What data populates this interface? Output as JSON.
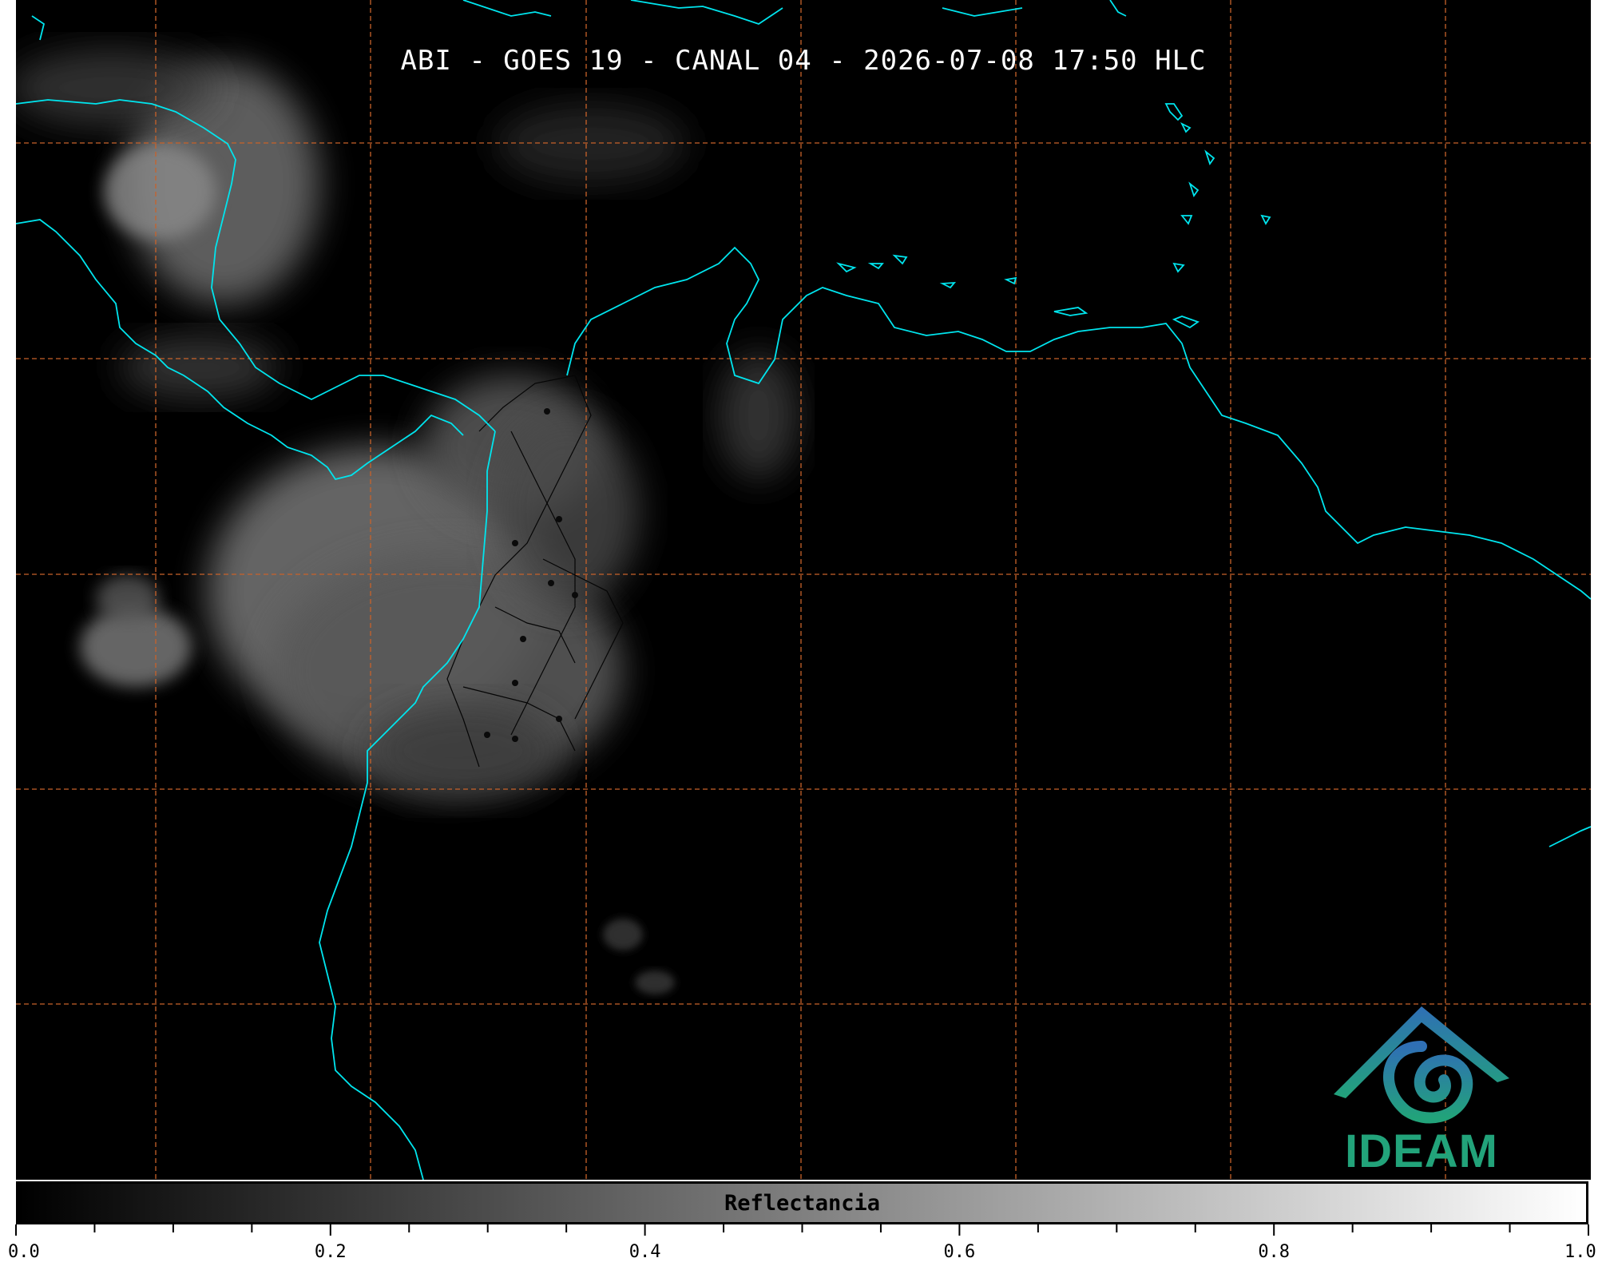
{
  "title": "ABI - GOES 19 - CANAL 04 - 2026-07-08 17:50 HLC",
  "map": {
    "coastline_color": "#00e5ee",
    "grid_color": "#c8622a",
    "background_color": "#000000",
    "borders_color": "#000000"
  },
  "colorbar": {
    "label": "Reflectancia",
    "min": 0.0,
    "max": 1.0,
    "ticks": [
      "0.0",
      "0.2",
      "0.4",
      "0.6",
      "0.8",
      "1.0"
    ],
    "colors": [
      "#000000",
      "#ffffff"
    ]
  },
  "logo": {
    "text": "IDEAM",
    "icon": "ideam-logo-icon"
  }
}
